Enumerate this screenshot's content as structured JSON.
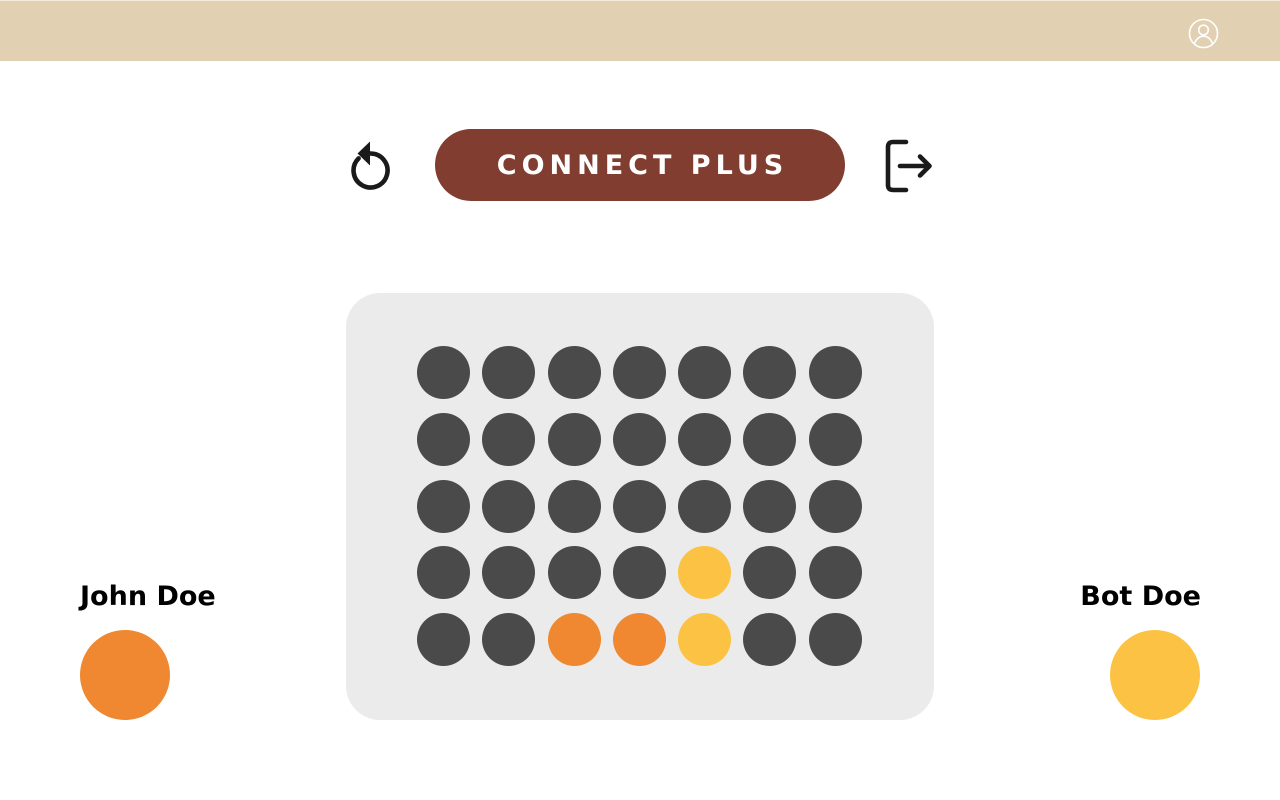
{
  "header": {
    "profile_icon": "user-circle-icon"
  },
  "toolbar": {
    "restart_icon": "restart-icon",
    "title": "CONNECT PLUS",
    "exit_icon": "logout-icon"
  },
  "board": {
    "rows": 5,
    "columns": 7,
    "cells": [
      [
        "empty",
        "empty",
        "empty",
        "empty",
        "empty",
        "empty",
        "empty"
      ],
      [
        "empty",
        "empty",
        "empty",
        "empty",
        "empty",
        "empty",
        "empty"
      ],
      [
        "empty",
        "empty",
        "empty",
        "empty",
        "empty",
        "empty",
        "empty"
      ],
      [
        "empty",
        "empty",
        "empty",
        "empty",
        "p2",
        "empty",
        "empty"
      ],
      [
        "empty",
        "empty",
        "p1",
        "p1",
        "p2",
        "empty",
        "empty"
      ]
    ]
  },
  "players": [
    {
      "name": "John Doe",
      "piece": "p1"
    },
    {
      "name": "Bot Doe",
      "piece": "p2"
    }
  ],
  "colors": {
    "header_bg": "#e2d0b3",
    "title_bg": "#803d30",
    "board_bg": "#ebebeb",
    "empty": "#4a4a4a",
    "p1": "#ef8831",
    "p2": "#fcc243",
    "icon": "#1a1a1a"
  }
}
